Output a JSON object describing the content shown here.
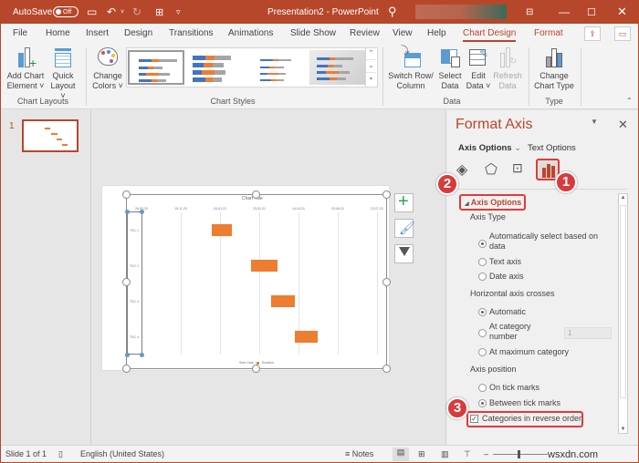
{
  "titlebar": {
    "autosave_label": "AutoSave",
    "autosave_state": "Off",
    "doc_title": "Presentation2 - PowerPoint",
    "icons": [
      "save-icon",
      "undo-icon",
      "redo-icon",
      "present-icon",
      "customize-icon",
      "search-icon",
      "ribbon-display-icon",
      "minimize-icon",
      "maximize-icon",
      "close-icon"
    ]
  },
  "tabs": [
    {
      "label": "File"
    },
    {
      "label": "Home"
    },
    {
      "label": "Insert"
    },
    {
      "label": "Design"
    },
    {
      "label": "Transitions"
    },
    {
      "label": "Animations"
    },
    {
      "label": "Slide Show"
    },
    {
      "label": "Review"
    },
    {
      "label": "View"
    },
    {
      "label": "Help"
    },
    {
      "label": "Chart Design",
      "active": true
    },
    {
      "label": "Format"
    }
  ],
  "ribbon": {
    "chart_layouts": {
      "group_label": "Chart Layouts",
      "add_chart_element": [
        "Add Chart",
        "Element ˅"
      ],
      "quick_layout": [
        "Quick",
        "Layout ˅"
      ]
    },
    "chart_styles": {
      "group_label": "Chart Styles",
      "change_colors": [
        "Change",
        "Colors ˅"
      ]
    },
    "data": {
      "group_label": "Data",
      "switch_row_column": [
        "Switch Row/",
        "Column"
      ],
      "select_data": [
        "Select",
        "Data"
      ],
      "edit_data": [
        "Edit",
        "Data ˅"
      ],
      "refresh_data": [
        "Refresh",
        "Data"
      ]
    },
    "type": {
      "group_label": "Type",
      "change_chart_type": [
        "Change",
        "Chart Type"
      ]
    },
    "colors": {
      "accent": "#b7472a",
      "bar_blue": "#4472c4",
      "bar_orange": "#ed7d31",
      "bar_gray": "#a5a5a5"
    }
  },
  "slides_panel": {
    "slide_number": "1"
  },
  "chart_data": {
    "type": "bar",
    "orientation": "horizontal",
    "subtype": "gantt (stacked bar, Start Date series hidden)",
    "title": "Chart Title",
    "categories": [
      "TSC 1",
      "TSC 2",
      "TSC 3",
      "TSC 4"
    ],
    "x_tick_labels": [
      "26-09-20",
      "15-11-20",
      "04-01-21",
      "23-02-21",
      "14-04-21",
      "03-06-21",
      "23-07-21"
    ],
    "xlim_days": [
      0,
      300
    ],
    "series": [
      {
        "name": "Start Date",
        "color": "none",
        "values_days_from_axis_start": [
          90,
          140,
          165,
          195
        ]
      },
      {
        "name": "Duration",
        "color": "#ed7d31",
        "values_days": [
          25,
          33,
          30,
          29
        ]
      }
    ],
    "legend": [
      "Start Date",
      "Duration"
    ],
    "legend_position": "bottom",
    "grid": "vertical gridlines",
    "categories_reversed": true
  },
  "chart_side_buttons": [
    "chart-elements-plus-icon",
    "chart-styles-brush-icon",
    "chart-filters-funnel-icon"
  ],
  "format_pane": {
    "title": "Format Axis",
    "tab_axis_options": "Axis Options",
    "tab_text_options": "Text Options",
    "section": "Axis Options",
    "axis_type_label": "Axis Type",
    "axis_type_options": [
      {
        "label": "Automatically select based on data",
        "checked": true
      },
      {
        "label": "Text axis",
        "checked": false
      },
      {
        "label": "Date axis",
        "checked": false
      }
    ],
    "h_axis_crosses_label": "Horizontal axis crosses",
    "h_axis_crosses_options": [
      {
        "label": "Automatic",
        "checked": true
      },
      {
        "label": "At category number",
        "checked": false,
        "value": "1"
      },
      {
        "label": "At maximum category",
        "checked": false
      }
    ],
    "axis_position_label": "Axis position",
    "axis_position_options": [
      {
        "label": "On tick marks",
        "checked": false
      },
      {
        "label": "Between tick marks",
        "checked": true
      }
    ],
    "reverse_order": {
      "label": "Categories in reverse order",
      "checked": true
    },
    "callouts": [
      "1",
      "2",
      "3"
    ]
  },
  "statusbar": {
    "slide_info": "Slide 1 of 1",
    "language": "English (United States)",
    "notes": "Notes",
    "watermark": "wsxdn.com"
  }
}
